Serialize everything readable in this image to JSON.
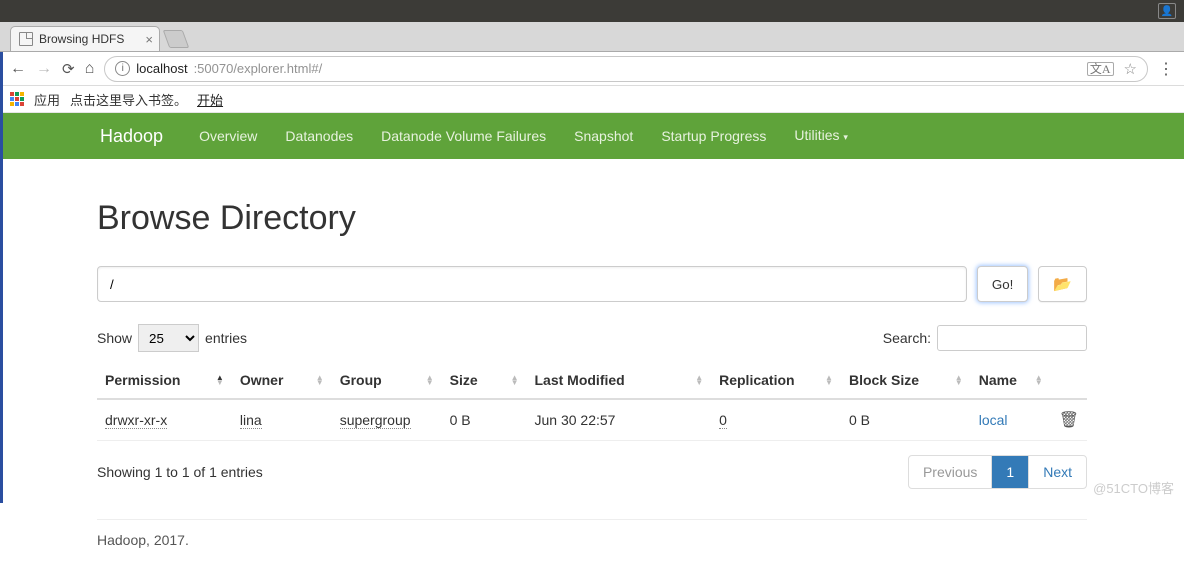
{
  "browser": {
    "tab_title": "Browsing HDFS",
    "url_host": "localhost",
    "url_rest": ":50070/explorer.html#/",
    "bookmark_bar": {
      "apps_label": "应用",
      "import_hint": "点击这里导入书签。",
      "start_link": "开始"
    }
  },
  "nav": {
    "brand": "Hadoop",
    "items": [
      "Overview",
      "Datanodes",
      "Datanode Volume Failures",
      "Snapshot",
      "Startup Progress",
      "Utilities"
    ]
  },
  "page": {
    "title": "Browse Directory",
    "path_value": "/",
    "go_label": "Go!",
    "show_label": "Show",
    "entries_label": "entries",
    "page_size": "25",
    "search_label": "Search:",
    "search_value": "",
    "columns": [
      "Permission",
      "Owner",
      "Group",
      "Size",
      "Last Modified",
      "Replication",
      "Block Size",
      "Name"
    ],
    "rows": [
      {
        "permission": "drwxr-xr-x",
        "owner": "lina",
        "group": "supergroup",
        "size": "0 B",
        "modified": "Jun 30 22:57",
        "replication": "0",
        "blocksize": "0 B",
        "name": "local"
      }
    ],
    "info_text": "Showing 1 to 1 of 1 entries",
    "pager": {
      "prev": "Previous",
      "next": "Next",
      "current": "1"
    },
    "footer": "Hadoop, 2017."
  },
  "watermark": "@51CTO博客"
}
